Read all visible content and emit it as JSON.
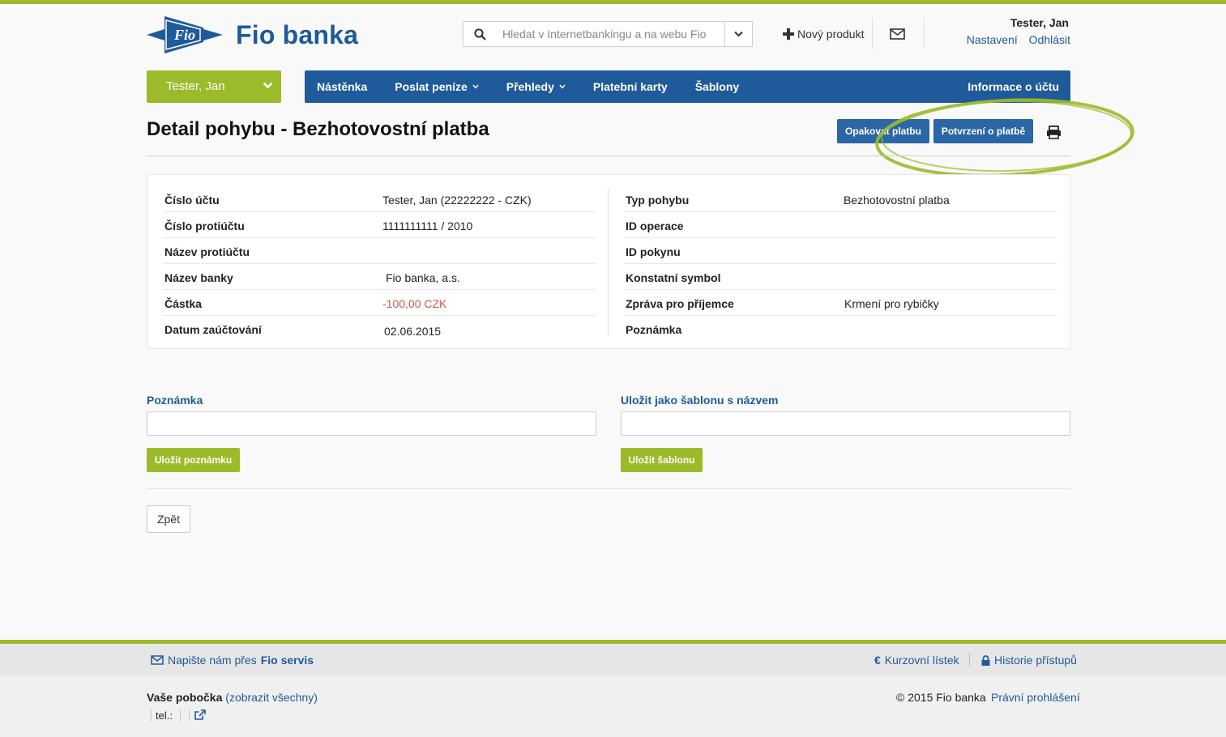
{
  "brand": {
    "name": "Fio banka",
    "logo_badge": "Fio"
  },
  "colors": {
    "brand_blue": "#1f5a9a",
    "brand_green": "#9bbb2a",
    "negative": "#d9534f"
  },
  "search": {
    "placeholder": "Hledat v Internetbankingu a na webu Fio"
  },
  "header": {
    "new_product": "Nový produkt",
    "user_name": "Tester, Jan",
    "settings": "Nastavení",
    "logout": "Odhlásit"
  },
  "user_selector": {
    "label": "Tester, Jan"
  },
  "nav": {
    "items": [
      {
        "label": "Nástěnka",
        "dropdown": false
      },
      {
        "label": "Poslat peníze",
        "dropdown": true
      },
      {
        "label": "Přehledy",
        "dropdown": true
      },
      {
        "label": "Platební karty",
        "dropdown": false
      },
      {
        "label": "Šablony",
        "dropdown": false
      }
    ],
    "account_info": "Informace o účtu"
  },
  "page": {
    "title": "Detail pohybu - Bezhotovostní platba",
    "repeat_button": "Opakovat platbu",
    "confirm_button": "Potvrzení o platbě"
  },
  "detail": {
    "left": [
      {
        "label": "Číslo účtu",
        "value": "Tester, Jan (22222222 - CZK)"
      },
      {
        "label": "Číslo protiúčtu",
        "value": "1111111111 / 2010"
      },
      {
        "label": "Název protiúčtu",
        "value": ""
      },
      {
        "label": "Název banky",
        "value": "Fio banka, a.s."
      },
      {
        "label": "Částka",
        "value": "-100,00 CZK"
      },
      {
        "label": "Datum zaúčtování",
        "value": "02.06.2015"
      }
    ],
    "right": [
      {
        "label": "Typ pohybu",
        "value": "Bezhotovostní platba"
      },
      {
        "label": "ID operace",
        "value": ""
      },
      {
        "label": "ID pokynu",
        "value": ""
      },
      {
        "label": "Konstatní symbol",
        "value": ""
      },
      {
        "label": "Zpráva pro příjemce",
        "value": "Krmení pro rybičky"
      },
      {
        "label": "Poznámka",
        "value": ""
      }
    ]
  },
  "forms": {
    "note_label": "Poznámka",
    "note_value": "",
    "save_note": "Uložit poznámku",
    "template_label": "Uložit jako šablonu s názvem",
    "template_value": "",
    "save_template": "Uložit šablonu"
  },
  "back_button": "Zpět",
  "footer": {
    "write_us": "Napište nám přes",
    "fio_servis": "Fio servis",
    "exchange_rates": "Kurzovní lístek",
    "access_history": "Historie přístupů",
    "branch_label": "Vaše pobočka",
    "show_all": "(zobrazit všechny)",
    "tel_label": "tel.:",
    "copyright": "© 2015 Fio banka",
    "legal": "Právní prohlášení"
  }
}
